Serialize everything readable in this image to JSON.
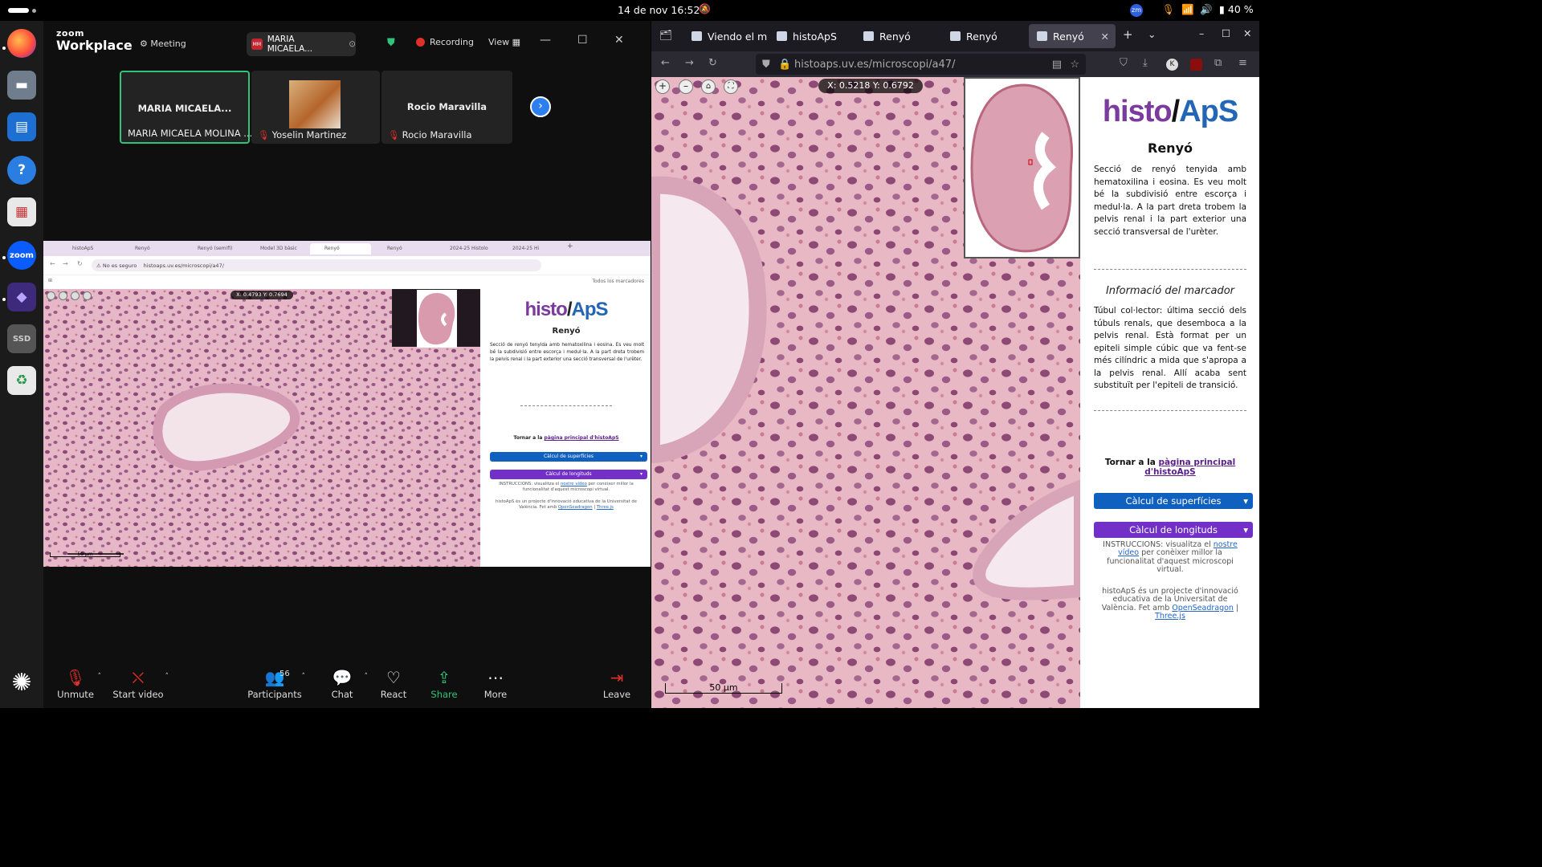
{
  "topbar": {
    "clock": "14 de nov  16:52",
    "battery": "40 %"
  },
  "zoom": {
    "logo_top": "zoom",
    "logo_bottom": "Workplace",
    "meeting_label": "Meeting",
    "chip_label": "MARIA MICAELA...",
    "chip_avatar": "MM",
    "recording_label": "Recording",
    "view_label": "View",
    "tiles": [
      {
        "big": "MARIA MICAELA...",
        "name": "MARIA MICAELA MOLINA ..."
      },
      {
        "name": "Yoselin Martinez"
      },
      {
        "big": "Rocio Maravilla",
        "name": "Rocio Maravilla"
      }
    ],
    "toolbar": {
      "unmute": "Unmute",
      "start_video": "Start video",
      "participants": "Participants",
      "participants_count": "56",
      "chat": "Chat",
      "react": "React",
      "share": "Share",
      "more": "More",
      "leave": "Leave"
    }
  },
  "shared": {
    "tabs": [
      "histoApS",
      "Renyó",
      "Renyó (semifi)",
      "Model 3D bàsic",
      "Renyó",
      "Renyó",
      "2024-25 Histolo",
      "2024-25 Hi"
    ],
    "security": "No es seguro",
    "url": "histoaps.uv.es/microscopi/a47/",
    "bookmarks": "Todos los marcadores",
    "coord": "X: 0.4793   Y: 0.7694",
    "scale": "50 µm",
    "logo_a": "histo",
    "logo_b": "ApS",
    "title": "Renyó",
    "desc": "Secció de renyó tenyida amb hematoxilina i eosina. Es veu molt bé la subdivisió entre escorça i medul·la. A la part dreta trobem la pelvis renal i la part exterior una secció transversal de l'urèter.",
    "back_prefix": "Tornar a la ",
    "back_link": "pàgina principal d'histoApS",
    "btn_surf": "Càlcul de superfícies",
    "btn_long": "Càlcul de longituds",
    "instr_prefix": "INSTRUCCIONS: visualitza el ",
    "instr_link": "nostre vídeo",
    "instr_suffix": " per conèixer millor la funcionalitat d'aquest microscopi virtual.",
    "foot_text": "histoApS és un projecte d'innovació educativa de la Universitat de València. Fet amb ",
    "foot_link1": "OpenSeadragon",
    "foot_sep": " | ",
    "foot_link2": "Three.js"
  },
  "firefox": {
    "tabs": [
      "Viendo el m",
      "histoApS",
      "Renyó",
      "Renyó",
      "Renyó"
    ],
    "url": "histoaps.uv.es/microscopi/a47/",
    "coord": "X: 0.5218   Y: 0.6792",
    "scale": "50 µm",
    "logo_a": "histo",
    "logo_b": "ApS",
    "title": "Renyó",
    "desc": "Secció de renyó tenyida amb hematoxilina i eosina. Es veu molt bé la subdivisió entre escorça i medul·la. A la part dreta trobem la pelvis renal i la part exterior una secció transversal de l'urèter.",
    "marker_title": "Informació del marcador",
    "marker_desc": "Túbul col·lector: última secció dels túbuls renals, que desemboca a la pelvis renal. Està format per un epiteli simple cúbic que va fent-se més cilíndric a mida que s'apropa a la pelvis renal. Allí acaba sent substituït per l'epiteli de transició.",
    "back_prefix": "Tornar a la ",
    "back_link": "pàgina principal d'histoApS",
    "btn_surf": "Càlcul de superfícies",
    "btn_long": "Càlcul de longituds",
    "instr_prefix": "INSTRUCCIONS: visualitza el ",
    "instr_link": "nostre vídeo",
    "instr_suffix": " per conèixer millor la funcionalitat d'aquest microscopi virtual.",
    "foot_text": "histoApS és un projecte d'innovació educativa de la Universitat de València. Fet amb ",
    "foot_link1": "OpenSeadragon",
    "foot_sep": " | ",
    "foot_link2": "Three.js"
  }
}
